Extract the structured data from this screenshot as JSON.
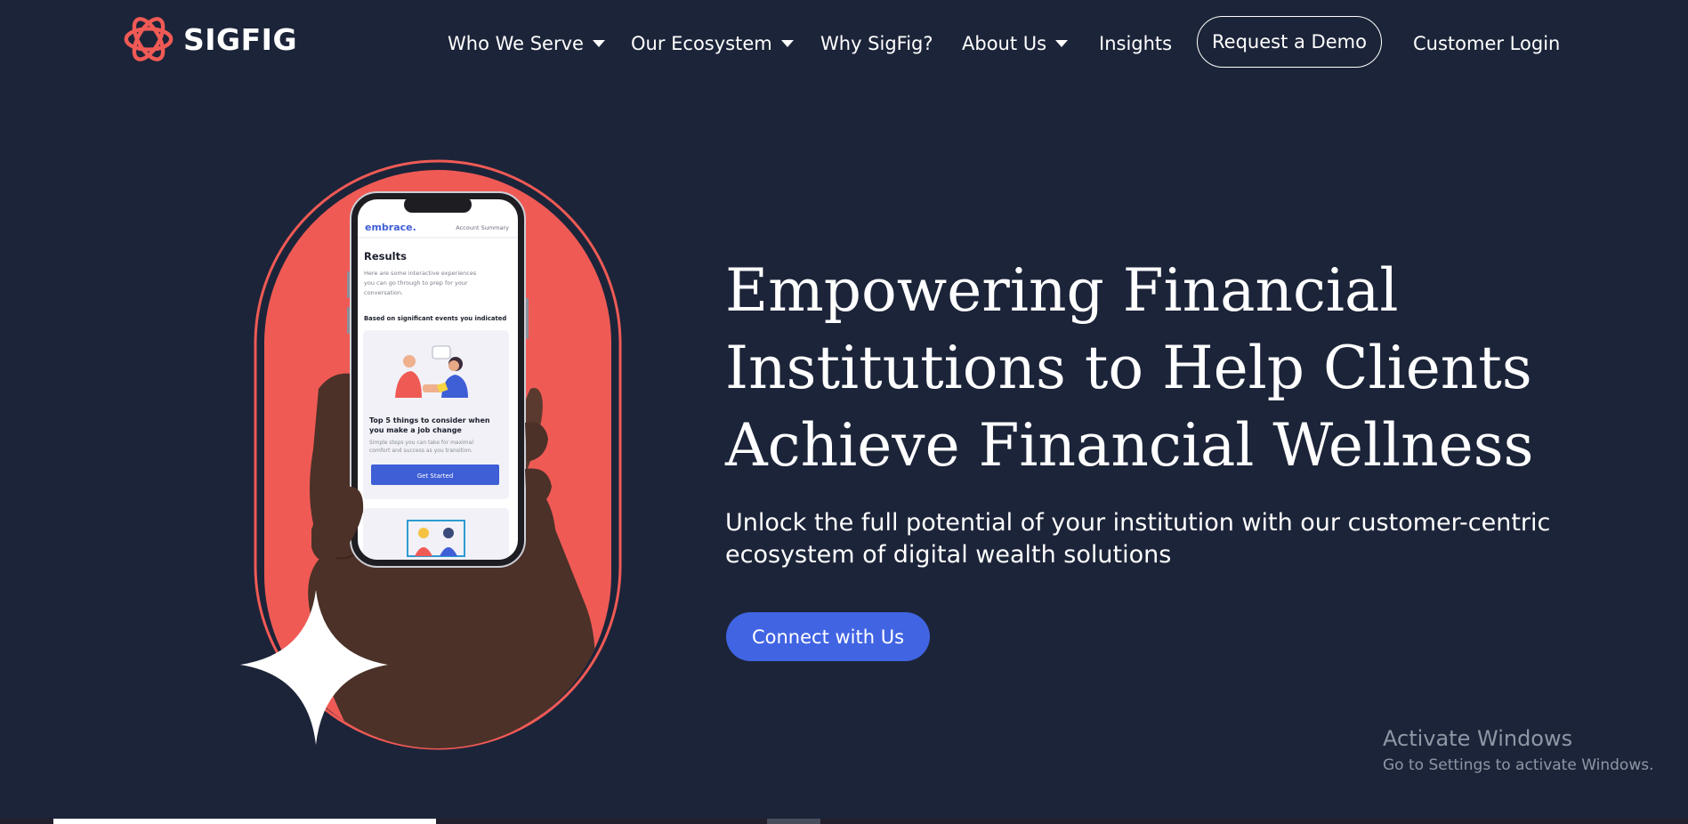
{
  "brand": {
    "name": "SIGFIG",
    "accent": "#f05a55",
    "background": "#1c2439",
    "cta_color": "#4164e3"
  },
  "nav": {
    "items": [
      {
        "label": "Who We Serve",
        "dropdown": true
      },
      {
        "label": "Our Ecosystem",
        "dropdown": true
      },
      {
        "label": "Why SigFig?",
        "dropdown": false
      },
      {
        "label": "About Us",
        "dropdown": true
      },
      {
        "label": "Insights",
        "dropdown": false
      }
    ],
    "demo_button": "Request a Demo",
    "login": "Customer Login"
  },
  "hero": {
    "headline_lines": [
      "Empowering Financial",
      "Institutions to Help Clients",
      "Achieve Financial Wellness"
    ],
    "sub_lines": [
      "Unlock the full potential of your institution with our customer-centric",
      "ecosystem of digital wealth solutions"
    ],
    "cta": "Connect with Us"
  },
  "phone": {
    "app_name": "embrace.",
    "header_link": "Account Summary",
    "title": "Results",
    "intro": [
      "Here are some interactive experiences",
      "you can go through to prep for your",
      "conversation."
    ],
    "section": "Based on significant events you indicated",
    "card_title": [
      "Top 5 things to consider when",
      "you make a job change"
    ],
    "card_body": [
      "Simple steps you can take for maximal",
      "comfort and success as you transition."
    ],
    "card_button": "Get Started"
  },
  "watermark": {
    "title": "Activate Windows",
    "subtitle": "Go to Settings to activate Windows."
  }
}
